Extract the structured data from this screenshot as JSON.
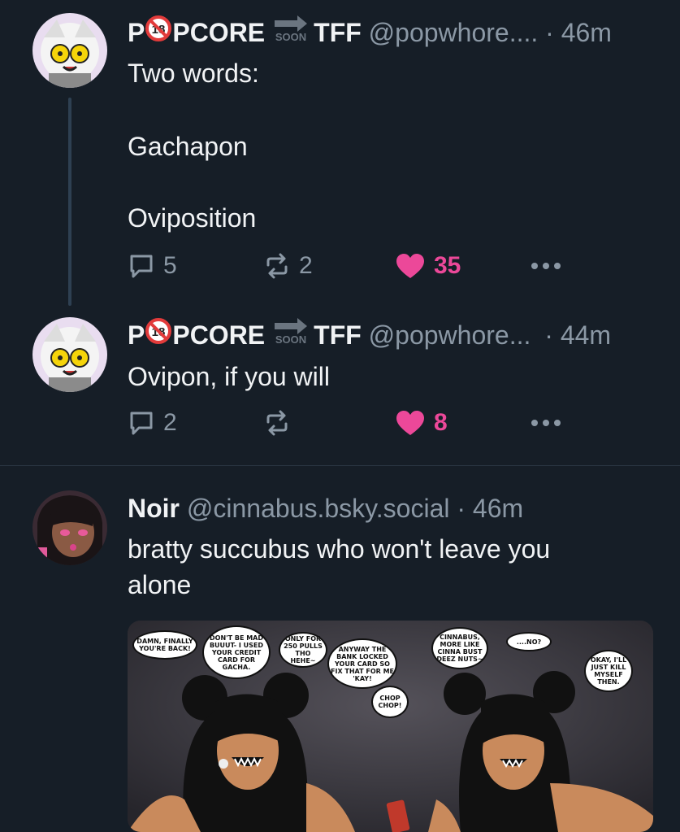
{
  "posts": [
    {
      "name_prefix": "P",
      "name_badge": "18",
      "name_suffix": "PCORE",
      "soon_label": "SOON",
      "name_tail": "TFF",
      "handle": "@popwhore....",
      "separator": "·",
      "time": "46m",
      "lines": [
        "Two words:",
        "Gachapon",
        "Oviposition"
      ],
      "replies": "5",
      "reposts": "2",
      "likes": "35"
    },
    {
      "name_prefix": "P",
      "name_badge": "18",
      "name_suffix": "PCORE",
      "soon_label": "SOON",
      "name_tail": "TFF",
      "handle": "@popwhore...",
      "separator": "·",
      "time": "44m",
      "lines": [
        "Ovipon, if you will"
      ],
      "replies": "2",
      "reposts": "",
      "likes": "8"
    },
    {
      "name": "Noir",
      "handle": "@cinnabus.bsky.social",
      "separator": "·",
      "time": "46m",
      "lines": [
        "bratty succubus who won't leave you",
        "alone"
      ]
    }
  ],
  "comic_bubbles": [
    "DAMN, FINALLY YOU'RE BACK!",
    "DON'T BE MAD BUUUT- I USED YOUR CREDIT CARD FOR GACHA.",
    "ONLY FOR 250 PULLS THO HEHE~",
    "ANYWAY THE BANK LOCKED YOUR CARD SO FIX THAT FOR ME 'KAY!",
    "CHOP CHOP!",
    "CINNABUS, MORE LIKE CINNA BUST DEEZ NUTS~",
    "....NO?",
    "OKAY, I'LL JUST KILL MYSELF THEN."
  ],
  "colors": {
    "background": "#161e27",
    "text": "#f1f3f5",
    "muted": "#8b98a5",
    "like": "#ec4899",
    "thread_line": "#2e4052"
  },
  "icons": [
    "reply-icon",
    "repost-icon",
    "heart-icon",
    "more-icon",
    "no-entry-18-icon",
    "arrow-soon-icon"
  ]
}
